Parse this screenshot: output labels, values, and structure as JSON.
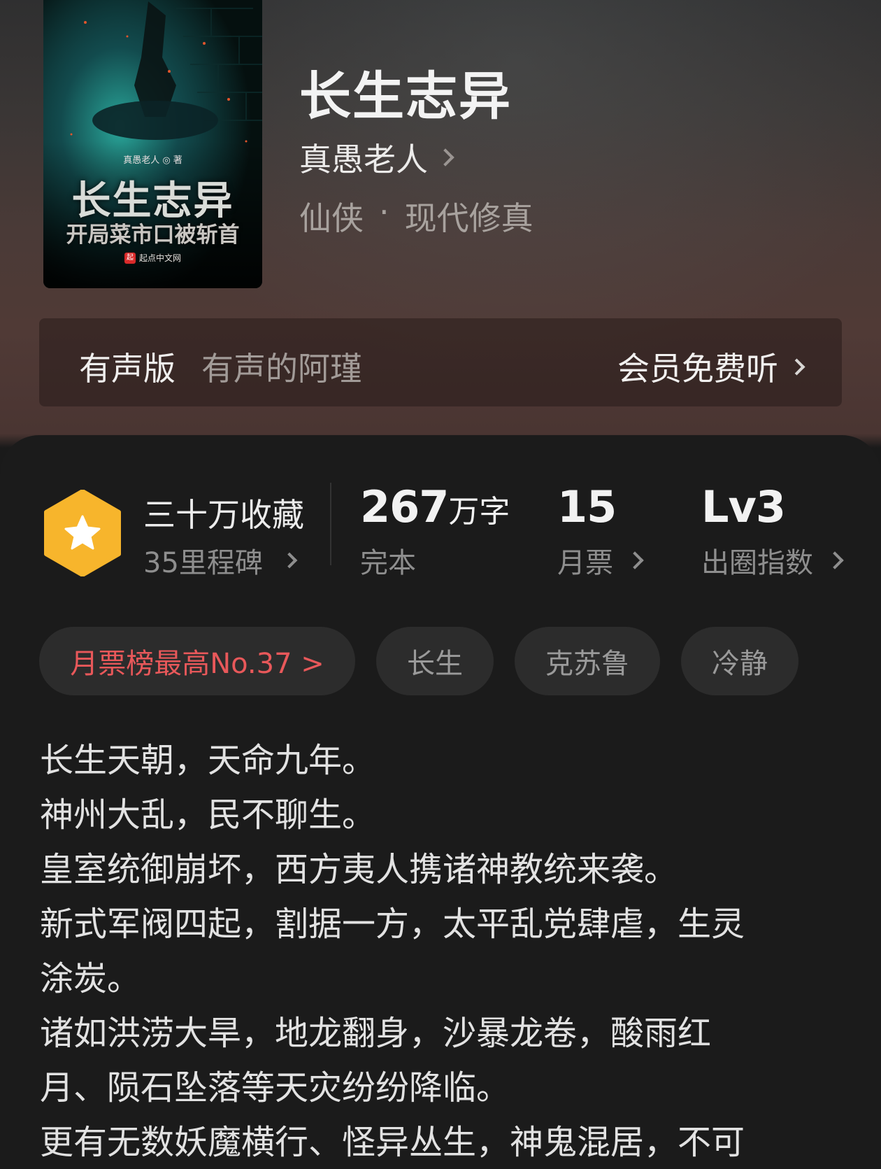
{
  "cover": {
    "author_mark": "真愚老人 ◎ 著",
    "title": "长生志异",
    "subtitle": "开局菜市口被斩首",
    "publisher_logo": "起",
    "publisher": "起点中文网"
  },
  "book": {
    "title": "长生志异",
    "author": "真愚老人",
    "genre": "仙侠",
    "separator": "·",
    "subgenre": "现代修真"
  },
  "audio": {
    "label": "有声版",
    "narrator": "有声的阿瑾",
    "action": "会员免费听"
  },
  "stats": {
    "collection": "三十万收藏",
    "milestones": "35里程碑",
    "words_num": "267",
    "words_unit": "万字",
    "status": "完本",
    "monthly_tickets": "15",
    "monthly_tickets_label": "月票",
    "level": "Lv3",
    "level_label": "出圈指数"
  },
  "tags": {
    "rank": "月票榜最高No.37 >",
    "items": [
      "长生",
      "克苏鲁",
      "冷静"
    ]
  },
  "synopsis": [
    "长生天朝，天命九年。",
    "神州大乱，民不聊生。",
    "皇室统御崩坏，西方夷人携诸神教统来袭。",
    "新式军阀四起，割据一方，太平乱党肆虐，生灵",
    "涂炭。",
    "诸如洪涝大旱，地龙翻身，沙暴龙卷，酸雨红",
    "月、陨石坠落等天灾纷纷降临。",
    "更有无数妖魔横行、怪异丛生，神鬼混居，不可"
  ],
  "colors": {
    "accent_red": "#e8585a",
    "badge_gold": "#f7b52c",
    "card_bg": "#1b1b1b"
  }
}
